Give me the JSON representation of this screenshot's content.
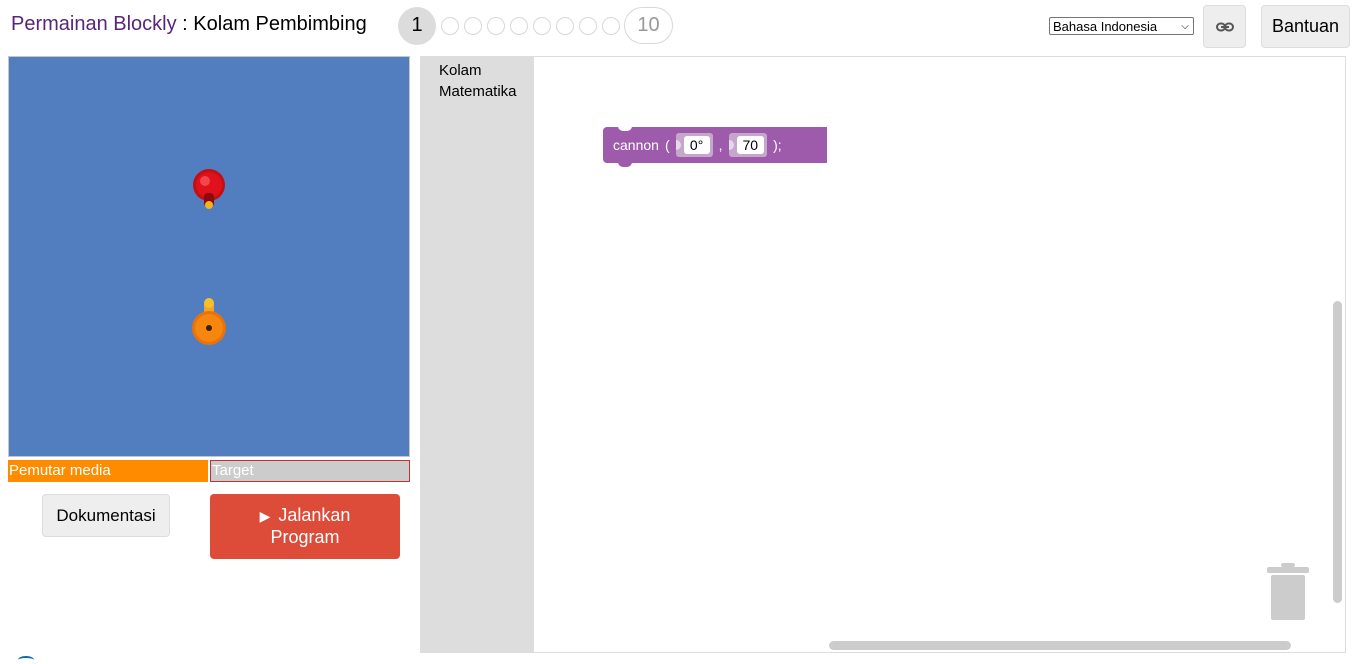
{
  "header": {
    "app_name": "Permainan Blockly",
    "separator": " : ",
    "page_name": "Kolam Pembimbing",
    "current_level": "1",
    "last_level": "10",
    "language": "Bahasa Indonesia",
    "help_label": "Bantuan"
  },
  "visualization": {
    "background": "#527dbf",
    "player_bar_label": "Pemutar media",
    "target_bar_label": "Target"
  },
  "controls": {
    "docs_label": "Dokumentasi",
    "run_line1": "Jalankan",
    "run_line2": "Program"
  },
  "workspace": {
    "categories": [
      "Kolam",
      "Matematika"
    ],
    "block": {
      "name": "cannon",
      "open_paren": "(",
      "comma": ",",
      "close": ");",
      "angle": "0°",
      "range": "70"
    }
  },
  "colors": {
    "brand": "#57267a",
    "run_button": "#dd4b39",
    "player_bar": "#ff8b00",
    "block": "#9e5bab"
  }
}
